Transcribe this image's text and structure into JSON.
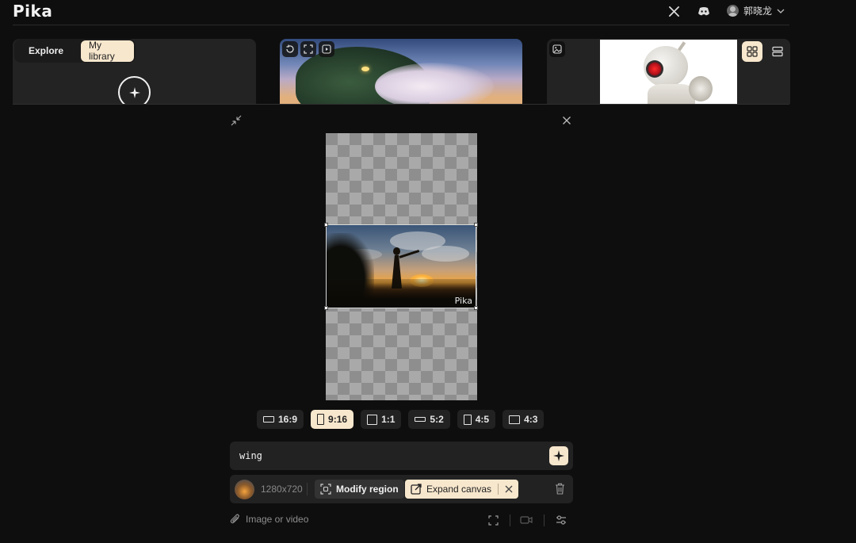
{
  "app": {
    "logo": "Pika"
  },
  "header": {
    "user_name": "郭晓龙",
    "icons": [
      "x-icon",
      "discord-icon",
      "chevron-down-icon"
    ]
  },
  "library": {
    "tabs": [
      {
        "label": "Explore"
      },
      {
        "label": "My library",
        "active": true
      }
    ]
  },
  "canvas": {
    "watermark": "Pika",
    "selected_ratio": "9:16"
  },
  "aspect_ratios": [
    {
      "label": "16:9"
    },
    {
      "label": "9:16"
    },
    {
      "label": "1:1"
    },
    {
      "label": "5:2"
    },
    {
      "label": "4:5"
    },
    {
      "label": "4:3"
    }
  ],
  "prompt": {
    "value": "wing"
  },
  "options": {
    "resolution": "1280x720",
    "modify_label": "Modify region",
    "expand_label": "Expand canvas"
  },
  "bottom_bar": {
    "attach_label": "Image or video"
  },
  "colors": {
    "accent": "#f7e7cd",
    "panel": "#222222",
    "background": "#0e0e0e"
  }
}
